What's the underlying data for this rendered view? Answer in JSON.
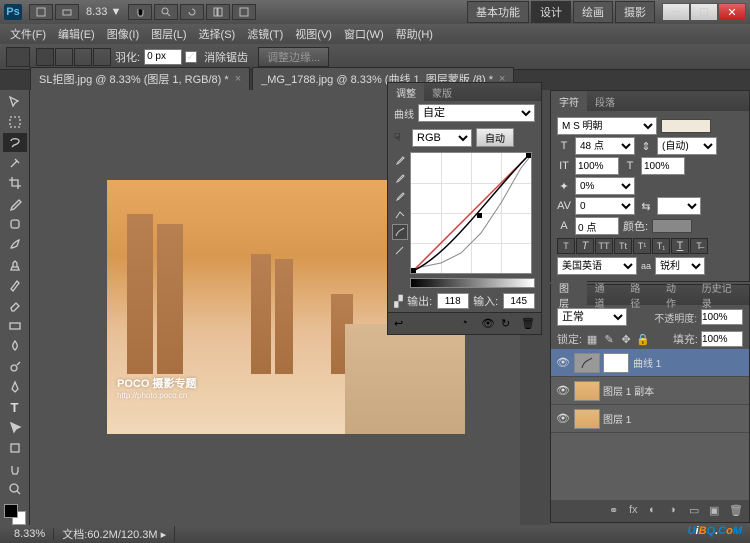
{
  "app": {
    "icon_label": "Ps",
    "zoom_display": "8.33",
    "workspaces": [
      "基本功能",
      "设计",
      "绘画",
      "摄影"
    ],
    "active_workspace": 1
  },
  "menu": {
    "items": [
      "文件(F)",
      "编辑(E)",
      "图像(I)",
      "图层(L)",
      "选择(S)",
      "滤镜(T)",
      "视图(V)",
      "窗口(W)",
      "帮助(H)"
    ]
  },
  "options": {
    "feather_label": "羽化:",
    "feather_value": "0 px",
    "antialias_label": "消除锯齿",
    "refine_btn": "调整边缘..."
  },
  "tabs": [
    {
      "label": "SL拒图.jpg @ 8.33% (图层 1, RGB/8) *"
    },
    {
      "label": "_MG_1788.jpg @ 8.33% (曲线 1, 图层蒙版 /8) *"
    }
  ],
  "watermark": {
    "main": "POCO 摄影专题",
    "sub": "http://photo.poco.cn"
  },
  "adjust": {
    "tabs": [
      "调整",
      "蒙版"
    ],
    "preset_label": "曲线",
    "preset_value": "自定",
    "channel": "RGB",
    "auto_btn": "自动",
    "output_label": "输出:",
    "output_value": "118",
    "input_label": "输入:",
    "input_value": "145"
  },
  "char": {
    "tabs": [
      "字符",
      "段落"
    ],
    "font": "M S 明朝",
    "size": "48 点",
    "leading": "(自动)",
    "tracking": "100%",
    "vtracking": "100%",
    "baseline": "0%",
    "kerning": "0",
    "scale": "0 点",
    "color_label": "颜色:",
    "lang": "美国英语",
    "aa": "锐利"
  },
  "layers": {
    "tabs": [
      "图层",
      "通道",
      "路径",
      "动作",
      "历史记录"
    ],
    "mode": "正常",
    "opacity_label": "不透明度:",
    "opacity": "100%",
    "lock_label": "锁定:",
    "fill_label": "填充:",
    "fill": "100%",
    "items": [
      {
        "name": "曲线 1",
        "has_mask": true,
        "selected": true
      },
      {
        "name": "图层 1 副本"
      },
      {
        "name": "图层 1"
      }
    ]
  },
  "status": {
    "zoom": "8.33%",
    "doc_label": "文档:",
    "doc": "60.2M/120.3M"
  },
  "brand": {
    "text": "UiBQ.CoM"
  }
}
